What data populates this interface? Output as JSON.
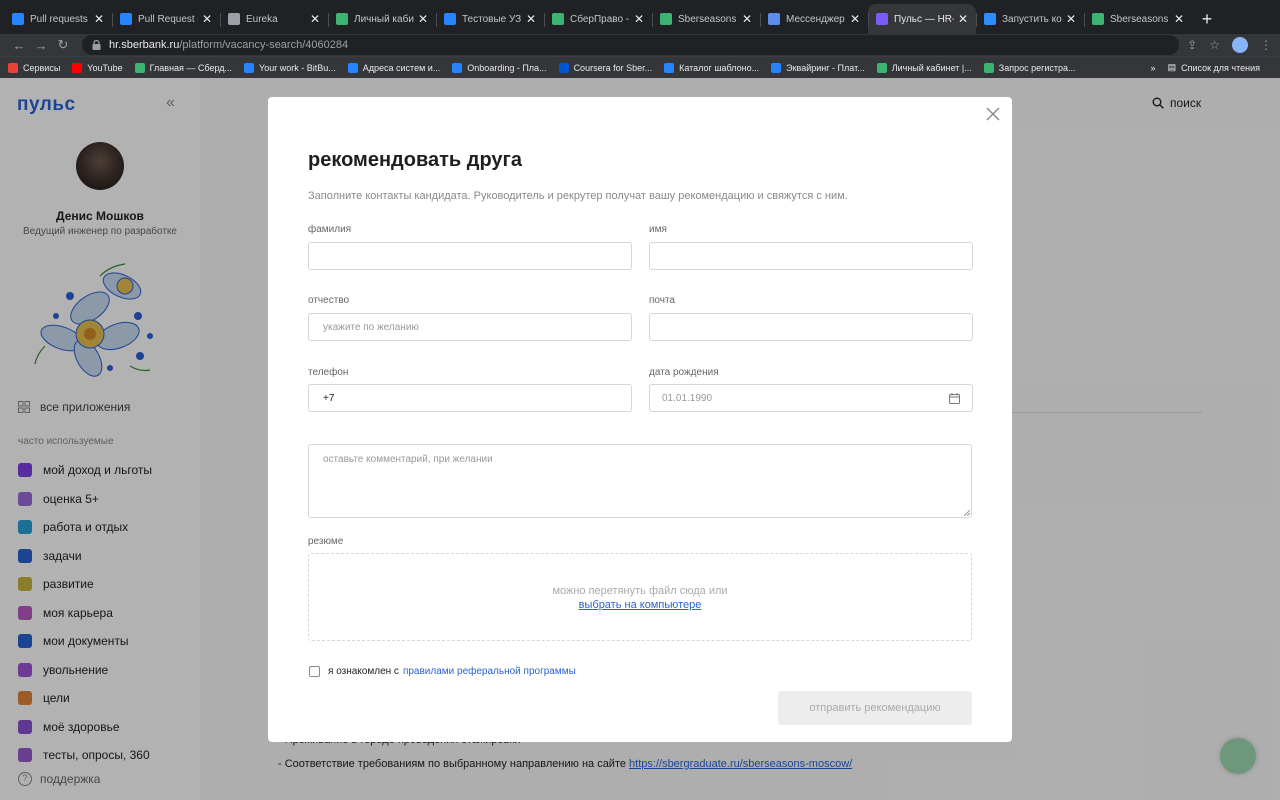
{
  "browser": {
    "tabs": [
      {
        "title": "Pull requests fo",
        "color": "#2684ff"
      },
      {
        "title": "Pull Request #",
        "color": "#2684ff"
      },
      {
        "title": "Eureka",
        "color": "#9aa0a6"
      },
      {
        "title": "Личный кабине",
        "color": "#3cb371"
      },
      {
        "title": "Тестовые УЗ н",
        "color": "#2684ff"
      },
      {
        "title": "СберПраво - ",
        "color": "#3cb371"
      },
      {
        "title": "Sberseasons - ",
        "color": "#3cb371"
      },
      {
        "title": "Мессенджер",
        "color": "#5b8def"
      },
      {
        "title": "Пульс — HR-пл",
        "color": "#7a5af8"
      },
      {
        "title": "Запустить кон",
        "color": "#2d8cff"
      },
      {
        "title": "Sberseasons - ",
        "color": "#3cb371"
      }
    ],
    "active_tab": 8,
    "url_host": "hr.sberbank.ru",
    "url_path": "/platform/vacancy-search/4060284",
    "bookmarks": [
      {
        "label": "Сервисы",
        "color": "#ea4335"
      },
      {
        "label": "YouTube",
        "color": "#ff0000"
      },
      {
        "label": "Главная — Сберд...",
        "color": "#3cb371"
      },
      {
        "label": "Your work - BitBu...",
        "color": "#2684ff"
      },
      {
        "label": "Адреса систем и...",
        "color": "#2684ff"
      },
      {
        "label": "Onboarding - Пла...",
        "color": "#2684ff"
      },
      {
        "label": "Coursera for Sber...",
        "color": "#0056d2"
      },
      {
        "label": "Каталог шаблоно...",
        "color": "#2684ff"
      },
      {
        "label": "Эквайринг - Плат...",
        "color": "#2684ff"
      },
      {
        "label": "Личный кабинет |...",
        "color": "#3cb371"
      },
      {
        "label": "Запрос регистра...",
        "color": "#3cb371"
      }
    ],
    "more": "»",
    "reading_list": "Список для чтения"
  },
  "sidebar": {
    "logo": "пульс",
    "user_name": "Денис Мошков",
    "user_role": "Ведущий инженер по разработке",
    "all_apps": "все приложения",
    "frequent_title": "часто используемые",
    "items": [
      {
        "label": "мой доход и льготы",
        "color": "#7b3fe4"
      },
      {
        "label": "оценка 5+",
        "color": "#9a6bdc"
      },
      {
        "label": "работа и отдых",
        "color": "#2a9fd6"
      },
      {
        "label": "задачи",
        "color": "#2a62d3"
      },
      {
        "label": "развитие",
        "color": "#c8b33c"
      },
      {
        "label": "моя карьера",
        "color": "#b85bc2"
      },
      {
        "label": "мои документы",
        "color": "#2a62d3"
      },
      {
        "label": "увольнение",
        "color": "#a054d6"
      },
      {
        "label": "цели",
        "color": "#e0843b"
      },
      {
        "label": "моё здоровье",
        "color": "#8a4fd0"
      },
      {
        "label": "тесты, опросы, 360",
        "color": "#9b59d0"
      }
    ],
    "support": "поддержка"
  },
  "header": {
    "search": "поиск"
  },
  "background": {
    "line1": "- Проживание в городе проведения стажировки",
    "line2_prefix": "- Соответствие требованиям по выбранному направлению на сайте ",
    "line2_link": "https://sbergraduate.ru/sberseasons-moscow/"
  },
  "modal": {
    "title": "рекомендовать друга",
    "subtitle": "Заполните контакты кандидата. Руководитель и рекрутер получат вашу рекомендацию и свяжутся с ним.",
    "fields": {
      "surname_label": "фамилия",
      "surname_value": "",
      "name_label": "имя",
      "name_value": "",
      "patronymic_label": "отчество",
      "patronymic_placeholder": "укажите по желанию",
      "email_label": "почта",
      "email_value": "",
      "phone_label": "телефон",
      "phone_value": "+7",
      "birth_label": "дата рождения",
      "birth_placeholder": "01.01.1990"
    },
    "comment_placeholder": "оставьте комментарий, при желании",
    "resume_label": "резюме",
    "drop_text": "можно перетянуть файл сюда или",
    "drop_link": "выбрать на компьютере",
    "agree_prefix": "я ознакомлен с",
    "agree_link": "правилами реферальной программы",
    "submit": "отправить рекомендацию"
  }
}
